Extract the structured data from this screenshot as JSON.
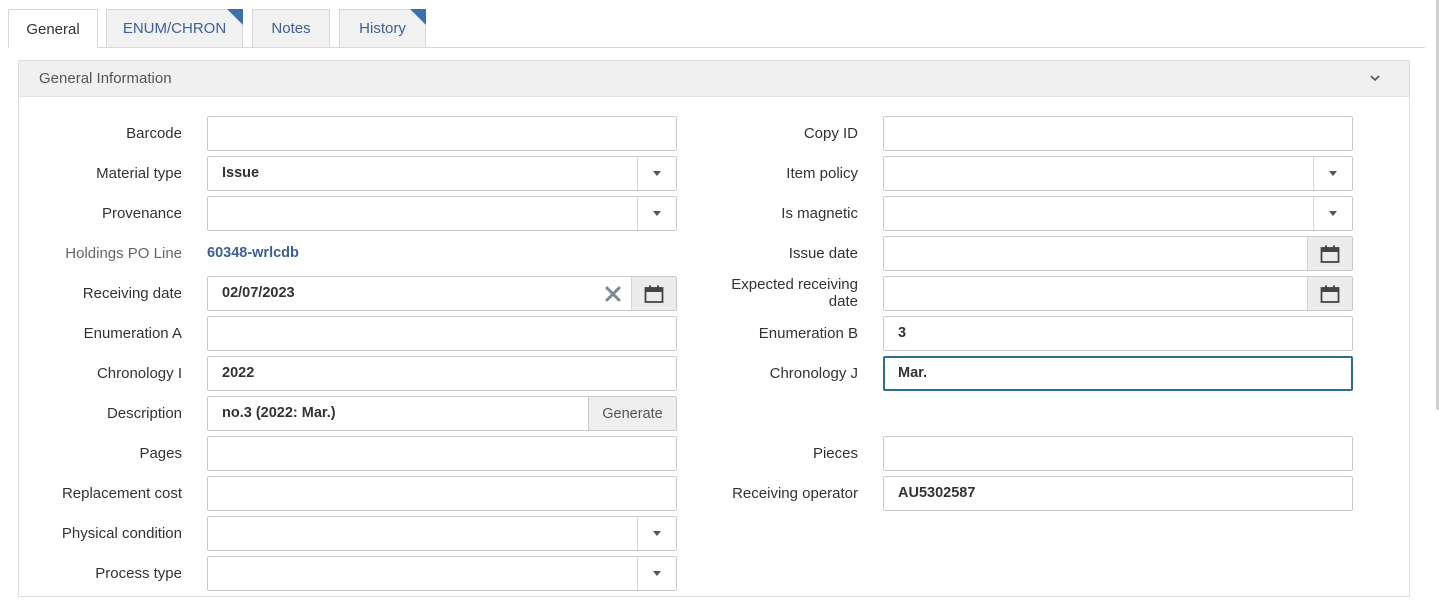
{
  "tabs": [
    {
      "label": "General",
      "active": true,
      "has_corner": false
    },
    {
      "label": "ENUM/CHRON",
      "active": false,
      "has_corner": true
    },
    {
      "label": "Notes",
      "active": false,
      "has_corner": false
    },
    {
      "label": "History",
      "active": false,
      "has_corner": true
    }
  ],
  "panel": {
    "title": "General Information"
  },
  "left": {
    "barcode": {
      "label": "Barcode",
      "value": ""
    },
    "material_type": {
      "label": "Material type",
      "value": "Issue"
    },
    "provenance": {
      "label": "Provenance",
      "value": ""
    },
    "holdings_po_line": {
      "label": "Holdings PO Line",
      "value": "60348-wrlcdb"
    },
    "receiving_date": {
      "label": "Receiving date",
      "value": "02/07/2023"
    },
    "enumeration_a": {
      "label": "Enumeration A",
      "value": ""
    },
    "chronology_i": {
      "label": "Chronology I",
      "value": "2022"
    },
    "description": {
      "label": "Description",
      "value": "no.3 (2022: Mar.)",
      "button": "Generate"
    },
    "pages": {
      "label": "Pages",
      "value": ""
    },
    "replacement_cost": {
      "label": "Replacement cost",
      "value": ""
    },
    "physical_condition": {
      "label": "Physical condition",
      "value": ""
    },
    "process_type": {
      "label": "Process type",
      "value": ""
    }
  },
  "right": {
    "copy_id": {
      "label": "Copy ID",
      "value": ""
    },
    "item_policy": {
      "label": "Item policy",
      "value": ""
    },
    "is_magnetic": {
      "label": "Is magnetic",
      "value": ""
    },
    "issue_date": {
      "label": "Issue date",
      "value": ""
    },
    "expected_receiving_date": {
      "label_line1": "Expected receiving",
      "label_line2": "date",
      "value": ""
    },
    "enumeration_b": {
      "label": "Enumeration B",
      "value": "3"
    },
    "chronology_j": {
      "label": "Chronology J",
      "value": "Mar."
    },
    "pieces": {
      "label": "Pieces",
      "value": ""
    },
    "receiving_operator": {
      "label": "Receiving operator",
      "value": "AU5302587"
    }
  },
  "colors": {
    "link": "#3b5f9a",
    "tab_corner": "#3b6fae",
    "focus_border": "#2a6f8f"
  },
  "icons": {
    "calendar": "calendar-icon",
    "dropdown": "chevron-down-icon",
    "clear": "clear-icon",
    "collapse": "chevron-down-icon"
  }
}
